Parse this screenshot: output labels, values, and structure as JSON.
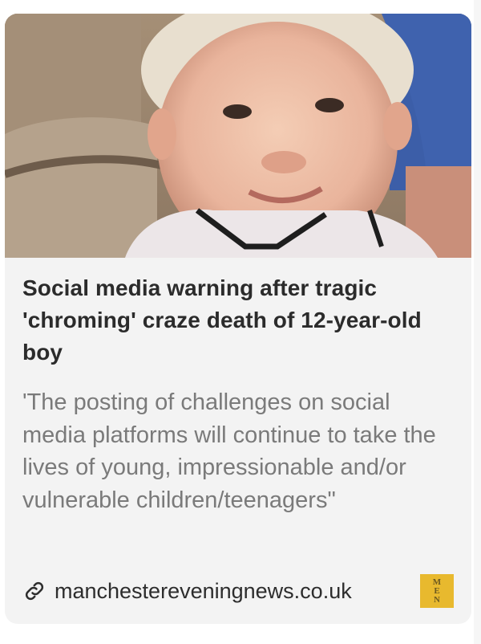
{
  "card": {
    "image_alt": "Photo of a smiling young boy",
    "title": "Social media warning after tragic 'chroming' craze death of 12-year-old boy",
    "description": "'The posting of challenges on social media platforms will continue to take the lives of young, impressionable and/or vulnerable children/teenagers\"",
    "source_domain": "manchestereveningnews.co.uk",
    "link_icon": "link-icon",
    "favicon_text": "MEN",
    "favicon_color": "#e8b92e"
  }
}
